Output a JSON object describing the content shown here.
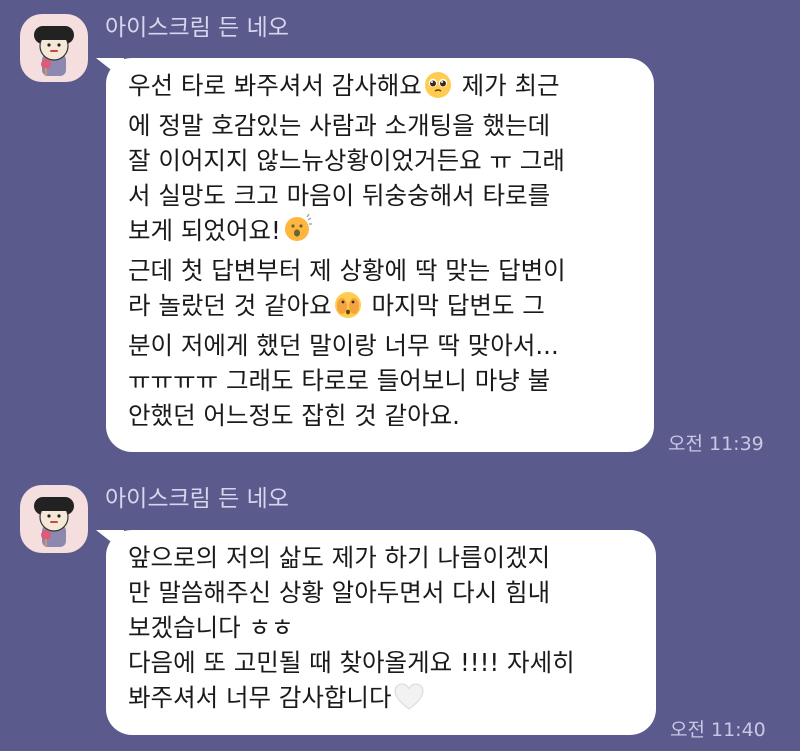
{
  "messages": [
    {
      "sender": "아이스크림 든 네오",
      "lines": [
        {
          "before": "우선 타로 봐주셔서 감사해요",
          "emoji": "pleading-face-icon",
          "after": " 제가 최근"
        },
        {
          "before": "에 정말 호감있는 사람과 소개팅을 했는데"
        },
        {
          "before": "잘 이어지지 않느뉴상황이었거든요 ㅠ 그래"
        },
        {
          "before": "서 실망도 크고 마음이 뒤숭숭해서 타로를"
        },
        {
          "before": "보게 되었어요!",
          "emoji": "astonished-face-icon",
          "after": ""
        },
        {
          "before": "근데 첫 답변부터 제 상황에 딱 맞는 답변이"
        },
        {
          "before": "라 놀랐던 것 같아요",
          "emoji": "face-peeking-icon",
          "after": " 마지막 답변도 그"
        },
        {
          "before": "분이 저에게 했던 말이랑 너무 딱 맞아서..."
        },
        {
          "before": "ㅠㅠㅠㅠ 그래도 타로로 들어보니 마냥 불"
        },
        {
          "before": "안했던 어느정도 잡힌 것 같아요."
        }
      ],
      "time": "오전 11:39"
    },
    {
      "sender": "아이스크림 든 네오",
      "lines": [
        {
          "before": "앞으로의 저의 삶도 제가 하기 나름이겠지"
        },
        {
          "before": "만 말씀해주신 상황 알아두면서 다시 힘내"
        },
        {
          "before": "보겠습니다 ㅎㅎ"
        },
        {
          "before": "다음에 또 고민될 때 찾아올게요 !!!! 자세히"
        },
        {
          "before": "봐주셔서 너무 감사합니다",
          "emoji": "white-heart-icon",
          "after": ""
        }
      ],
      "time": "오전 11:40"
    }
  ]
}
